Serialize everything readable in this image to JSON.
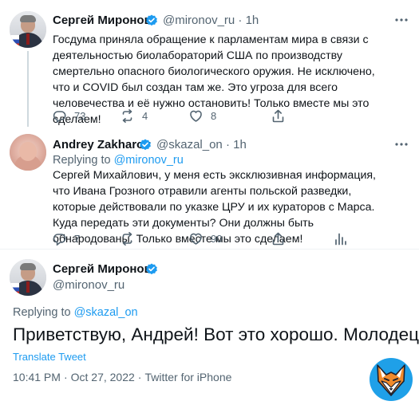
{
  "tweets": [
    {
      "name": "Сергей Миронов",
      "handle": "@mironov_ru · 1h",
      "text": "Госдума приняла обращение к парламентам мира в связи с деятельностью биолабораторий США по производству смертельно опасного биологического оружия. Не исключено, что и COVID был создан там же. Это угроза для всего человечества и её нужно остановить! Только вместе мы это сделаем!",
      "replies": "73",
      "retweets": "4",
      "likes": "8"
    },
    {
      "name": "Andrey Zakharov",
      "handle": "@skazal_on · 1h",
      "replying_prefix": "Replying to",
      "replying_mention": "@mironov_ru",
      "text": "Сергей Михайлович, у меня есть эксклюзивная информация, что Ивана Грозного отравили агенты польской разведки, которые действовали по указке ЦРУ и их кураторов с Марса. Куда передать эти документы? Они должны быть обнародованы. Только вместе мы это сделаем!",
      "replies": "7",
      "retweets": "",
      "likes": "90"
    }
  ],
  "main_tweet": {
    "name": "Сергей Миронов",
    "handle": "@mironov_ru",
    "replying_prefix": "Replying to",
    "replying_mention": "@skazal_on",
    "text": "Приветствую, Андрей! Вот это хорошо. Молодец!",
    "translate": "Translate Tweet",
    "time": "10:41 PM",
    "date": "Oct 27, 2022",
    "source": "Twitter for iPhone",
    "separator": "·"
  },
  "colors": {
    "accent": "#1d9bf0",
    "secondary_text": "#536471",
    "primary_text": "#0f1419",
    "divider": "#eff3f4"
  },
  "icons": [
    "verified-icon",
    "more-icon",
    "reply-icon",
    "retweet-icon",
    "like-icon",
    "share-icon",
    "analytics-icon",
    "fox-logo"
  ]
}
